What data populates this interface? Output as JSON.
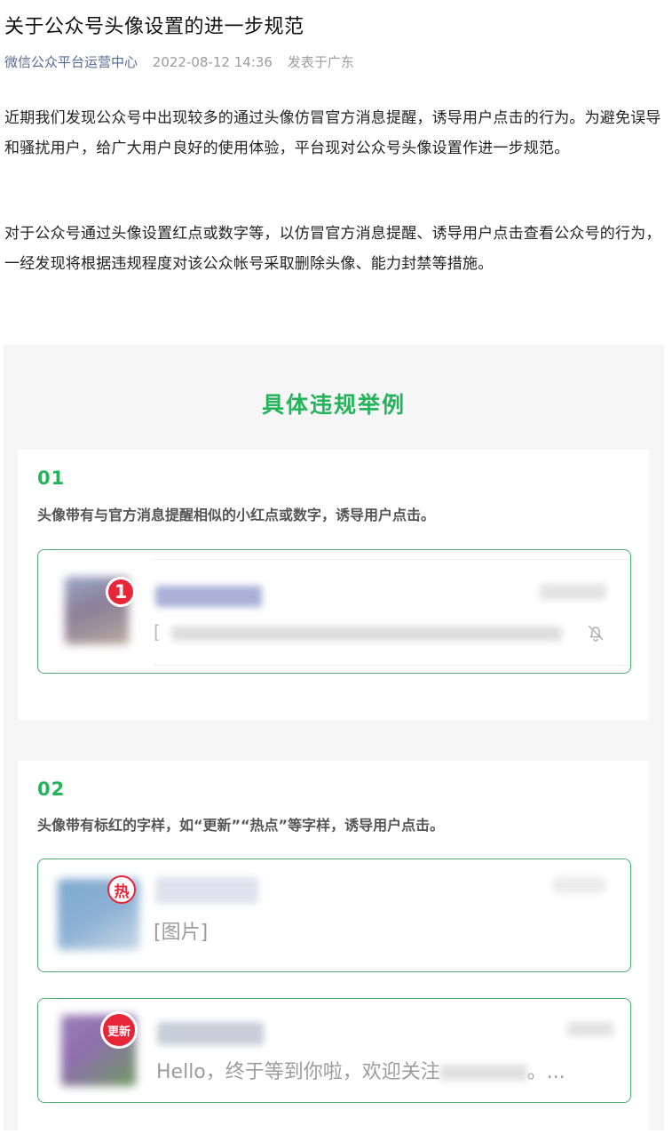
{
  "article": {
    "title": "关于公众号头像设置的进一步规范",
    "account": "微信公众平台运营中心",
    "datetime": "2022-08-12 14:36",
    "location": "发表于广东",
    "paragraphs": [
      "近期我们发现公众号中出现较多的通过头像仿冒官方消息提醒，诱导用户点击的行为。为避免误导和骚扰用户，给广大用户良好的使用体验，平台现对公众号头像设置作进一步规范。",
      "对于公众号通过头像设置红点或数字等，以仿冒官方消息提醒、诱导用户点击查看公众号的行为，一经发现将根据违规程度对该公众帐号采取删除头像、能力封禁等措施。"
    ]
  },
  "examples": {
    "heading": "具体违规举例",
    "items": [
      {
        "number": "01",
        "description": "头像带有与官方消息提醒相似的小红点或数字，诱导用户点击。",
        "badge": "1"
      },
      {
        "number": "02",
        "description": "头像带有标红的字样，如“更新”“热点”等字样，诱导用户点击。",
        "chats": [
          {
            "badge": "热",
            "preview": "[图片]"
          },
          {
            "badge": "更新",
            "preview_start": "Hello，终于等到你啦，欢迎关注",
            "preview_end": "。..."
          }
        ]
      }
    ]
  },
  "colors": {
    "accent": "#25b35b",
    "link": "#576b95",
    "badge_red": "#e8263a"
  },
  "icons": {
    "mute": "bell-slash-icon"
  }
}
